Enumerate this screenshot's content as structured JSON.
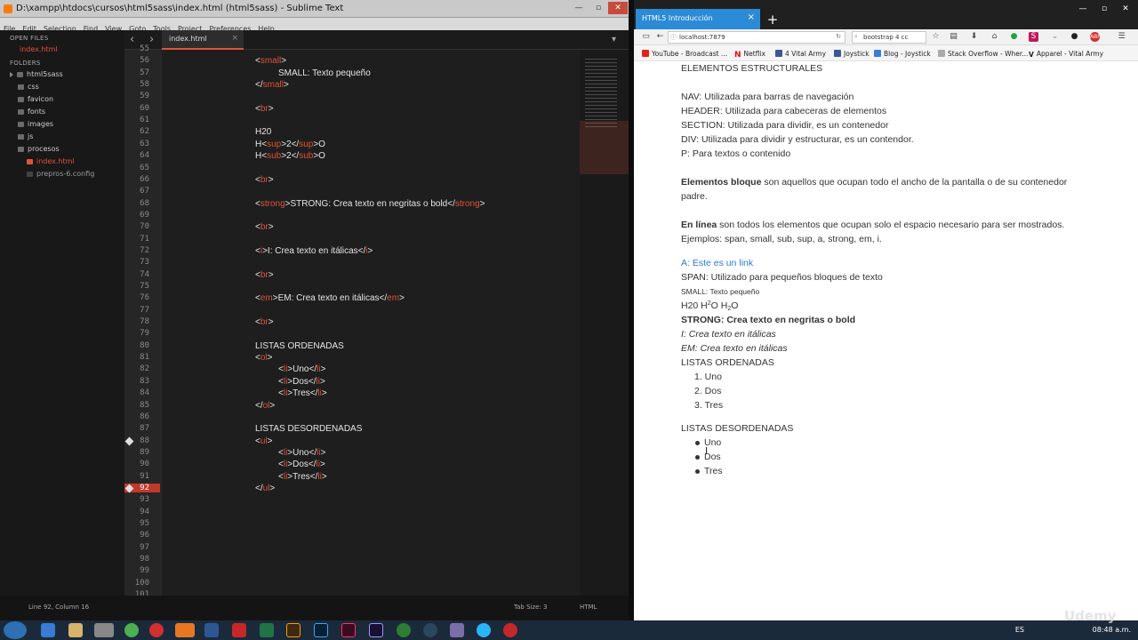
{
  "sublime": {
    "title": "D:\\xampp\\htdocs\\cursos\\html5sass\\index.html (html5sass) - Sublime Text",
    "menu": [
      "File",
      "Edit",
      "Selection",
      "Find",
      "View",
      "Goto",
      "Tools",
      "Project",
      "Preferences",
      "Help"
    ],
    "sidebar": {
      "open_files_header": "OPEN FILES",
      "open_file": "index.html",
      "folders_header": "FOLDERS",
      "root": "html5sass",
      "items": [
        "css",
        "favicon",
        "fonts",
        "images",
        "js",
        "procesos",
        "index.html",
        "prepros-6.config"
      ]
    },
    "tab": "index.html",
    "line_numbers": [
      "55",
      "56",
      "57",
      "58",
      "59",
      "60",
      "61",
      "62",
      "63",
      "64",
      "65",
      "66",
      "67",
      "68",
      "69",
      "70",
      "71",
      "72",
      "73",
      "74",
      "75",
      "76",
      "77",
      "78",
      "79",
      "80",
      "81",
      "82",
      "83",
      "84",
      "85",
      "86",
      "87",
      "88",
      "89",
      "90",
      "91",
      "92",
      "93",
      "94",
      "95",
      "96",
      "97",
      "98",
      "99",
      "100",
      "101"
    ],
    "current_line": "92",
    "status": {
      "position": "Line 92, Column 16",
      "tab_size": "Tab Size: 3",
      "syntax": "HTML"
    },
    "accent": "#e0533a"
  },
  "browser": {
    "tab_title": "HTML5 Introducción",
    "url": "localhost:7879",
    "search": "bootstrap 4 cc",
    "bookmarks": [
      "YouTube - Broadcast ...",
      "Netflix",
      "4  Vital Army",
      "Joystick",
      "Blog - Joystick",
      "Stack Overflow - Wher...",
      "Apparel - Vital Army"
    ],
    "content": {
      "heading": "ELEMENTOS ESTRUCTURALES",
      "nav": "NAV: Utilizada para barras de navegación",
      "header": "HEADER: Utilizada para cabeceras de elementos",
      "section": "SECTION: Utilizada para dividir, es un contenedor",
      "div": "DIV: Utilizada para dividir y estructurar, es un contendor.",
      "p": "P: Para textos o contenido",
      "bloque_bold": "Elementos bloque",
      "bloque_rest1": " son aquellos que ocupan todo el ancho de la pantalla o de su contenedor",
      "bloque_rest2": "padre.",
      "linea_bold": "En línea",
      "linea_rest1": " son todos los elementos que ocupan solo el espacio necesario para ser mostrados.",
      "linea_rest2": "Ejemplos: span, small, sub, sup, a, strong, em, i.",
      "link": "A: Este es un link",
      "span": "SPAN: Utilizado para pequeños bloques de texto",
      "small": "SMALL: Texto pequeño",
      "h2o_a": "H20 H",
      "h2o_sup": "2",
      "h2o_b": "O H",
      "h2o_sub": "2",
      "h2o_c": "O",
      "strong": "STRONG: Crea texto en negritas o bold",
      "i": "I: Crea texto en itálicas",
      "em": "EM: Crea texto en itálicas",
      "ol_title": "LISTAS ORDENADAS",
      "ol": [
        "1. Uno",
        "2. Dos",
        "3. Tres"
      ],
      "ul_title": "LISTAS DESORDENADAS",
      "ul": [
        "Uno",
        "Dos",
        "Tres"
      ]
    }
  },
  "taskbar": {
    "lang": "ES",
    "time": "08:48 a.m."
  },
  "watermark": "Udemy"
}
